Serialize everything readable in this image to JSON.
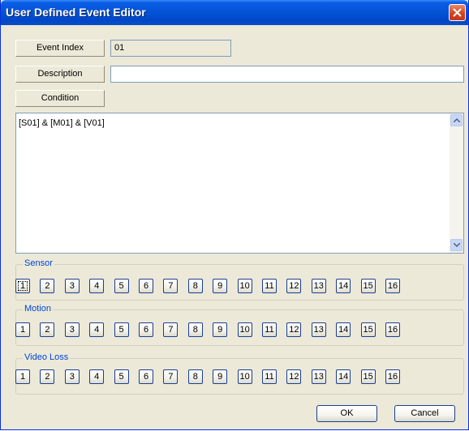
{
  "window": {
    "title": "User Defined Event Editor"
  },
  "fields": {
    "event_index_label": "Event Index",
    "event_index_value": "01",
    "description_label": "Description",
    "description_value": "",
    "condition_label": "Condition",
    "condition_value": "[S01] & [M01] & [V01]"
  },
  "groups": [
    {
      "label": "Sensor",
      "buttons": [
        "1",
        "2",
        "3",
        "4",
        "5",
        "6",
        "7",
        "8",
        "9",
        "10",
        "11",
        "12",
        "13",
        "14",
        "15",
        "16"
      ]
    },
    {
      "label": "Motion",
      "buttons": [
        "1",
        "2",
        "3",
        "4",
        "5",
        "6",
        "7",
        "8",
        "9",
        "10",
        "11",
        "12",
        "13",
        "14",
        "15",
        "16"
      ]
    },
    {
      "label": "Video Loss",
      "buttons": [
        "1",
        "2",
        "3",
        "4",
        "5",
        "6",
        "7",
        "8",
        "9",
        "10",
        "11",
        "12",
        "13",
        "14",
        "15",
        "16"
      ]
    }
  ],
  "actions": {
    "ok_label": "OK",
    "cancel_label": "Cancel"
  },
  "icons": {
    "close": "close-icon",
    "scroll_up": "scroll-up-arrow-icon",
    "scroll_down": "scroll-down-arrow-icon"
  },
  "colors": {
    "title_bar": "#0554d8",
    "close_button": "#d6441e",
    "group_label": "#0046d5",
    "dialog_bg": "#ece9d8"
  }
}
